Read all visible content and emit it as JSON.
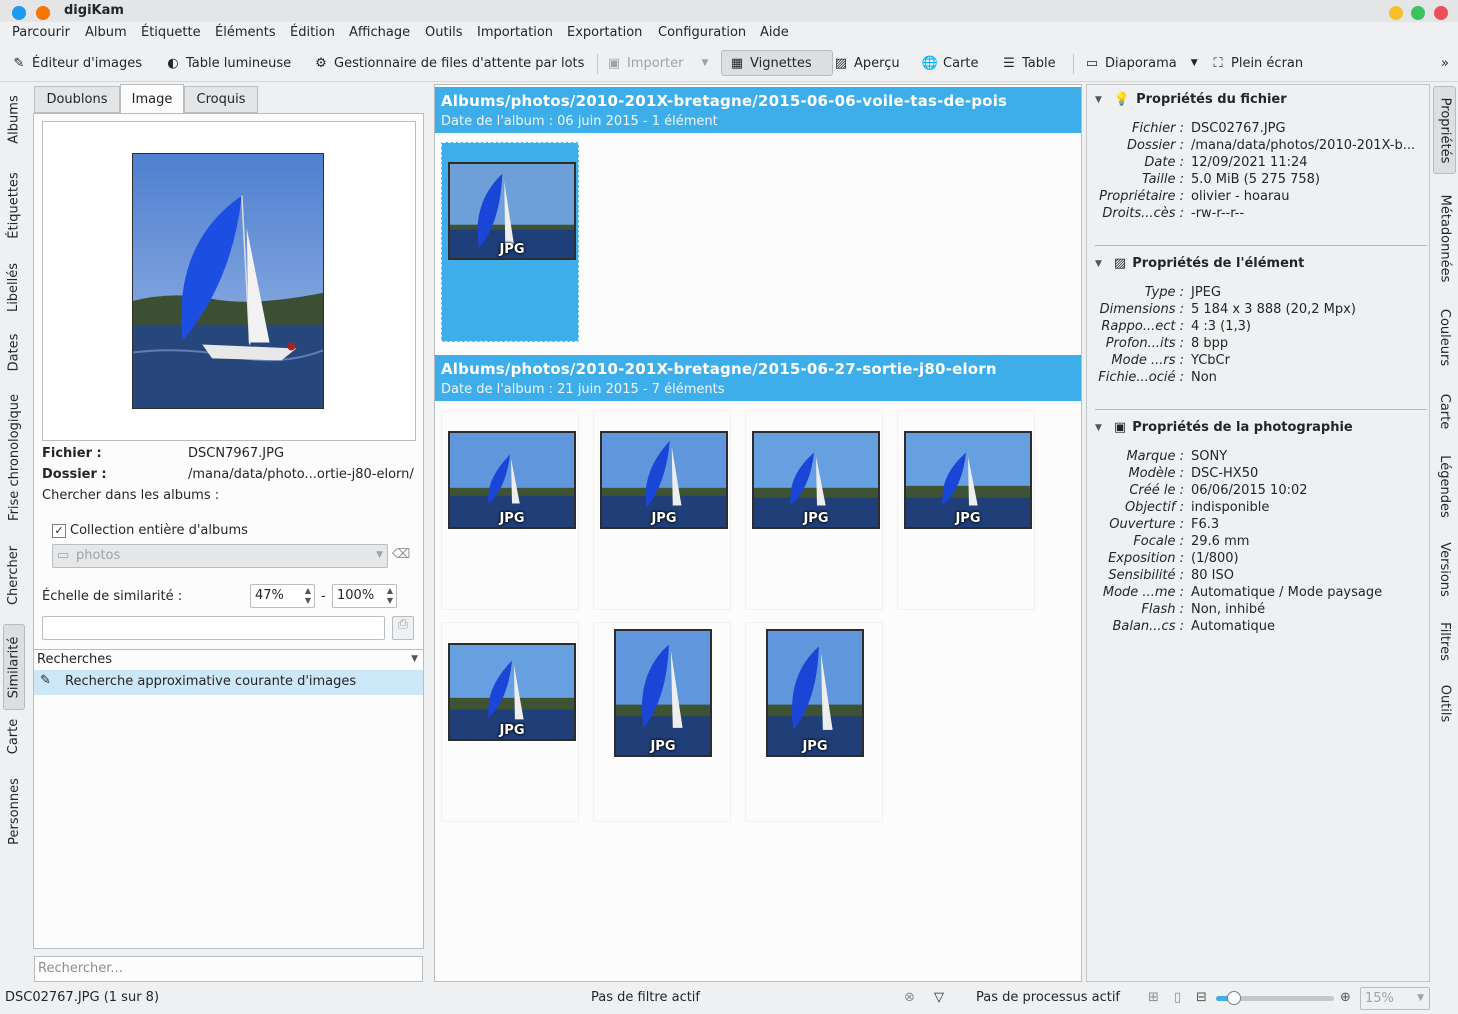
{
  "app": {
    "title": "digiKam"
  },
  "menu": [
    "Parcourir",
    "Album",
    "Étiquette",
    "Éléments",
    "Édition",
    "Affichage",
    "Outils",
    "Importation",
    "Exportation",
    "Configuration",
    "Aide"
  ],
  "toolbar": {
    "image_editor": "Éditeur d'images",
    "light_table": "Table lumineuse",
    "batch_queue": "Gestionnaire de files d'attente par lots",
    "import": "Importer",
    "thumbnails": "Vignettes",
    "preview": "Aperçu",
    "map": "Carte",
    "table": "Table",
    "slideshow": "Diaporama",
    "fullscreen": "Plein écran",
    "more": "»"
  },
  "left_sidebar": [
    "Albums",
    "Étiquettes",
    "Libellés",
    "Dates",
    "Frise chronologique",
    "Chercher",
    "Similarité",
    "Carte",
    "Personnes"
  ],
  "right_sidebar": [
    "Propriétés",
    "Métadonnées",
    "Couleurs",
    "Carte",
    "Légendes",
    "Versions",
    "Filtres",
    "Outils"
  ],
  "similarity": {
    "tabs": [
      "Doublons",
      "Image",
      "Croquis"
    ],
    "file_label": "Fichier :",
    "file_value": "DSCN7967.JPG",
    "folder_label": "Dossier :",
    "folder_value": "/mana/data/photo...ortie-j80-elorn/",
    "search_in_label": "Chercher dans les albums :",
    "whole_collection": "Collection entière d'albums",
    "album_select": "photos",
    "scale_label": "Échelle de similarité :",
    "scale_min": "47%",
    "scale_dash": "-",
    "scale_max": "100%",
    "searches_header": "Recherches",
    "searches_item": "Recherche approximative courante d'images",
    "search_placeholder": "Rechercher..."
  },
  "albums": [
    {
      "title": "Albums/photos/2010-201X-bretagne/2015-06-06-voile-tas-de-pois",
      "subtitle": "Date de l'album : 06 juin 2015 - 1 élément"
    },
    {
      "title": "Albums/photos/2010-201X-bretagne/2015-06-27-sortie-j80-elorn",
      "subtitle": "Date de l'album : 21 juin 2015 - 7 éléments"
    }
  ],
  "thumb_label": "JPG",
  "properties": {
    "file_section": "Propriétés du fichier",
    "file": [
      [
        "Fichier :",
        "DSC02767.JPG"
      ],
      [
        "Dossier :",
        "/mana/data/photos/2010-201X-b..."
      ],
      [
        "Date :",
        "12/09/2021 11:24"
      ],
      [
        "Taille :",
        "5.0 MiB (5 275 758)"
      ],
      [
        "Propriétaire :",
        "olivier - hoarau"
      ],
      [
        "Droits...cès :",
        "-rw-r--r--"
      ]
    ],
    "item_section": "Propriétés de l'élément",
    "item": [
      [
        "Type :",
        "JPEG"
      ],
      [
        "Dimensions :",
        "5 184 x 3 888 (20,2 Mpx)"
      ],
      [
        "Rappo...ect :",
        "4 :3 (1,3)"
      ],
      [
        "Profon...its :",
        "8 bpp"
      ],
      [
        "Mode ...rs :",
        "YCbCr"
      ],
      [
        "Fichie...ocié :",
        "Non"
      ]
    ],
    "photo_section": "Propriétés de la photographie",
    "photo": [
      [
        "Marque :",
        "SONY"
      ],
      [
        "Modèle :",
        "DSC-HX50"
      ],
      [
        "Créé le :",
        "06/06/2015 10:02"
      ],
      [
        "Objectif :",
        "indisponible"
      ],
      [
        "Ouverture :",
        "F6.3"
      ],
      [
        "Focale :",
        "29.6 mm"
      ],
      [
        "Exposition :",
        "(1/800)"
      ],
      [
        "Sensibilité :",
        "80 ISO"
      ],
      [
        "Mode ...me :",
        "Automatique / Mode paysage"
      ],
      [
        "Flash :",
        "Non, inhibé"
      ],
      [
        "Balan...cs :",
        "Automatique"
      ]
    ]
  },
  "status": {
    "left": "DSC02767.JPG (1 sur 8)",
    "filter": "Pas de filtre actif",
    "process": "Pas de processus actif",
    "zoom": "15%",
    "zoom_level": 0.15
  },
  "colors": {
    "accent": "#3daee9",
    "window": "#eff0f1"
  }
}
